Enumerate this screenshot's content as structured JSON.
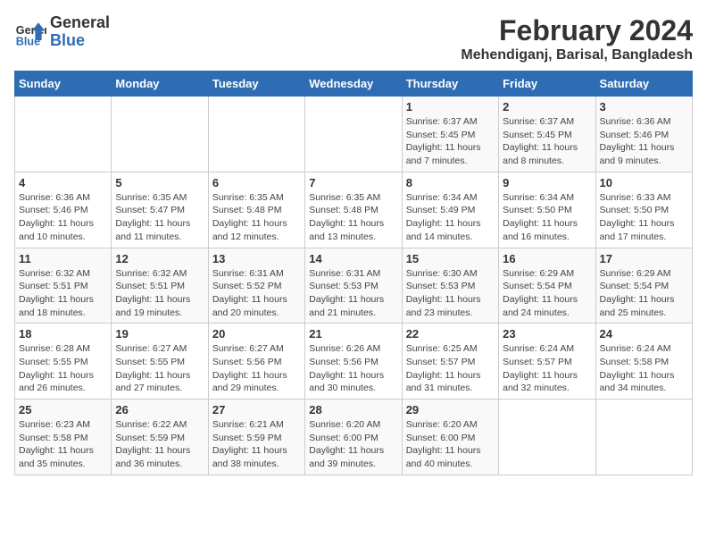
{
  "logo": {
    "line1": "General",
    "line2": "Blue"
  },
  "title": "February 2024",
  "subtitle": "Mehendiganj, Barisal, Bangladesh",
  "weekdays": [
    "Sunday",
    "Monday",
    "Tuesday",
    "Wednesday",
    "Thursday",
    "Friday",
    "Saturday"
  ],
  "weeks": [
    [
      {
        "day": "",
        "info": ""
      },
      {
        "day": "",
        "info": ""
      },
      {
        "day": "",
        "info": ""
      },
      {
        "day": "",
        "info": ""
      },
      {
        "day": "1",
        "info": "Sunrise: 6:37 AM\nSunset: 5:45 PM\nDaylight: 11 hours and 7 minutes."
      },
      {
        "day": "2",
        "info": "Sunrise: 6:37 AM\nSunset: 5:45 PM\nDaylight: 11 hours and 8 minutes."
      },
      {
        "day": "3",
        "info": "Sunrise: 6:36 AM\nSunset: 5:46 PM\nDaylight: 11 hours and 9 minutes."
      }
    ],
    [
      {
        "day": "4",
        "info": "Sunrise: 6:36 AM\nSunset: 5:46 PM\nDaylight: 11 hours and 10 minutes."
      },
      {
        "day": "5",
        "info": "Sunrise: 6:35 AM\nSunset: 5:47 PM\nDaylight: 11 hours and 11 minutes."
      },
      {
        "day": "6",
        "info": "Sunrise: 6:35 AM\nSunset: 5:48 PM\nDaylight: 11 hours and 12 minutes."
      },
      {
        "day": "7",
        "info": "Sunrise: 6:35 AM\nSunset: 5:48 PM\nDaylight: 11 hours and 13 minutes."
      },
      {
        "day": "8",
        "info": "Sunrise: 6:34 AM\nSunset: 5:49 PM\nDaylight: 11 hours and 14 minutes."
      },
      {
        "day": "9",
        "info": "Sunrise: 6:34 AM\nSunset: 5:50 PM\nDaylight: 11 hours and 16 minutes."
      },
      {
        "day": "10",
        "info": "Sunrise: 6:33 AM\nSunset: 5:50 PM\nDaylight: 11 hours and 17 minutes."
      }
    ],
    [
      {
        "day": "11",
        "info": "Sunrise: 6:32 AM\nSunset: 5:51 PM\nDaylight: 11 hours and 18 minutes."
      },
      {
        "day": "12",
        "info": "Sunrise: 6:32 AM\nSunset: 5:51 PM\nDaylight: 11 hours and 19 minutes."
      },
      {
        "day": "13",
        "info": "Sunrise: 6:31 AM\nSunset: 5:52 PM\nDaylight: 11 hours and 20 minutes."
      },
      {
        "day": "14",
        "info": "Sunrise: 6:31 AM\nSunset: 5:53 PM\nDaylight: 11 hours and 21 minutes."
      },
      {
        "day": "15",
        "info": "Sunrise: 6:30 AM\nSunset: 5:53 PM\nDaylight: 11 hours and 23 minutes."
      },
      {
        "day": "16",
        "info": "Sunrise: 6:29 AM\nSunset: 5:54 PM\nDaylight: 11 hours and 24 minutes."
      },
      {
        "day": "17",
        "info": "Sunrise: 6:29 AM\nSunset: 5:54 PM\nDaylight: 11 hours and 25 minutes."
      }
    ],
    [
      {
        "day": "18",
        "info": "Sunrise: 6:28 AM\nSunset: 5:55 PM\nDaylight: 11 hours and 26 minutes."
      },
      {
        "day": "19",
        "info": "Sunrise: 6:27 AM\nSunset: 5:55 PM\nDaylight: 11 hours and 27 minutes."
      },
      {
        "day": "20",
        "info": "Sunrise: 6:27 AM\nSunset: 5:56 PM\nDaylight: 11 hours and 29 minutes."
      },
      {
        "day": "21",
        "info": "Sunrise: 6:26 AM\nSunset: 5:56 PM\nDaylight: 11 hours and 30 minutes."
      },
      {
        "day": "22",
        "info": "Sunrise: 6:25 AM\nSunset: 5:57 PM\nDaylight: 11 hours and 31 minutes."
      },
      {
        "day": "23",
        "info": "Sunrise: 6:24 AM\nSunset: 5:57 PM\nDaylight: 11 hours and 32 minutes."
      },
      {
        "day": "24",
        "info": "Sunrise: 6:24 AM\nSunset: 5:58 PM\nDaylight: 11 hours and 34 minutes."
      }
    ],
    [
      {
        "day": "25",
        "info": "Sunrise: 6:23 AM\nSunset: 5:58 PM\nDaylight: 11 hours and 35 minutes."
      },
      {
        "day": "26",
        "info": "Sunrise: 6:22 AM\nSunset: 5:59 PM\nDaylight: 11 hours and 36 minutes."
      },
      {
        "day": "27",
        "info": "Sunrise: 6:21 AM\nSunset: 5:59 PM\nDaylight: 11 hours and 38 minutes."
      },
      {
        "day": "28",
        "info": "Sunrise: 6:20 AM\nSunset: 6:00 PM\nDaylight: 11 hours and 39 minutes."
      },
      {
        "day": "29",
        "info": "Sunrise: 6:20 AM\nSunset: 6:00 PM\nDaylight: 11 hours and 40 minutes."
      },
      {
        "day": "",
        "info": ""
      },
      {
        "day": "",
        "info": ""
      }
    ]
  ]
}
